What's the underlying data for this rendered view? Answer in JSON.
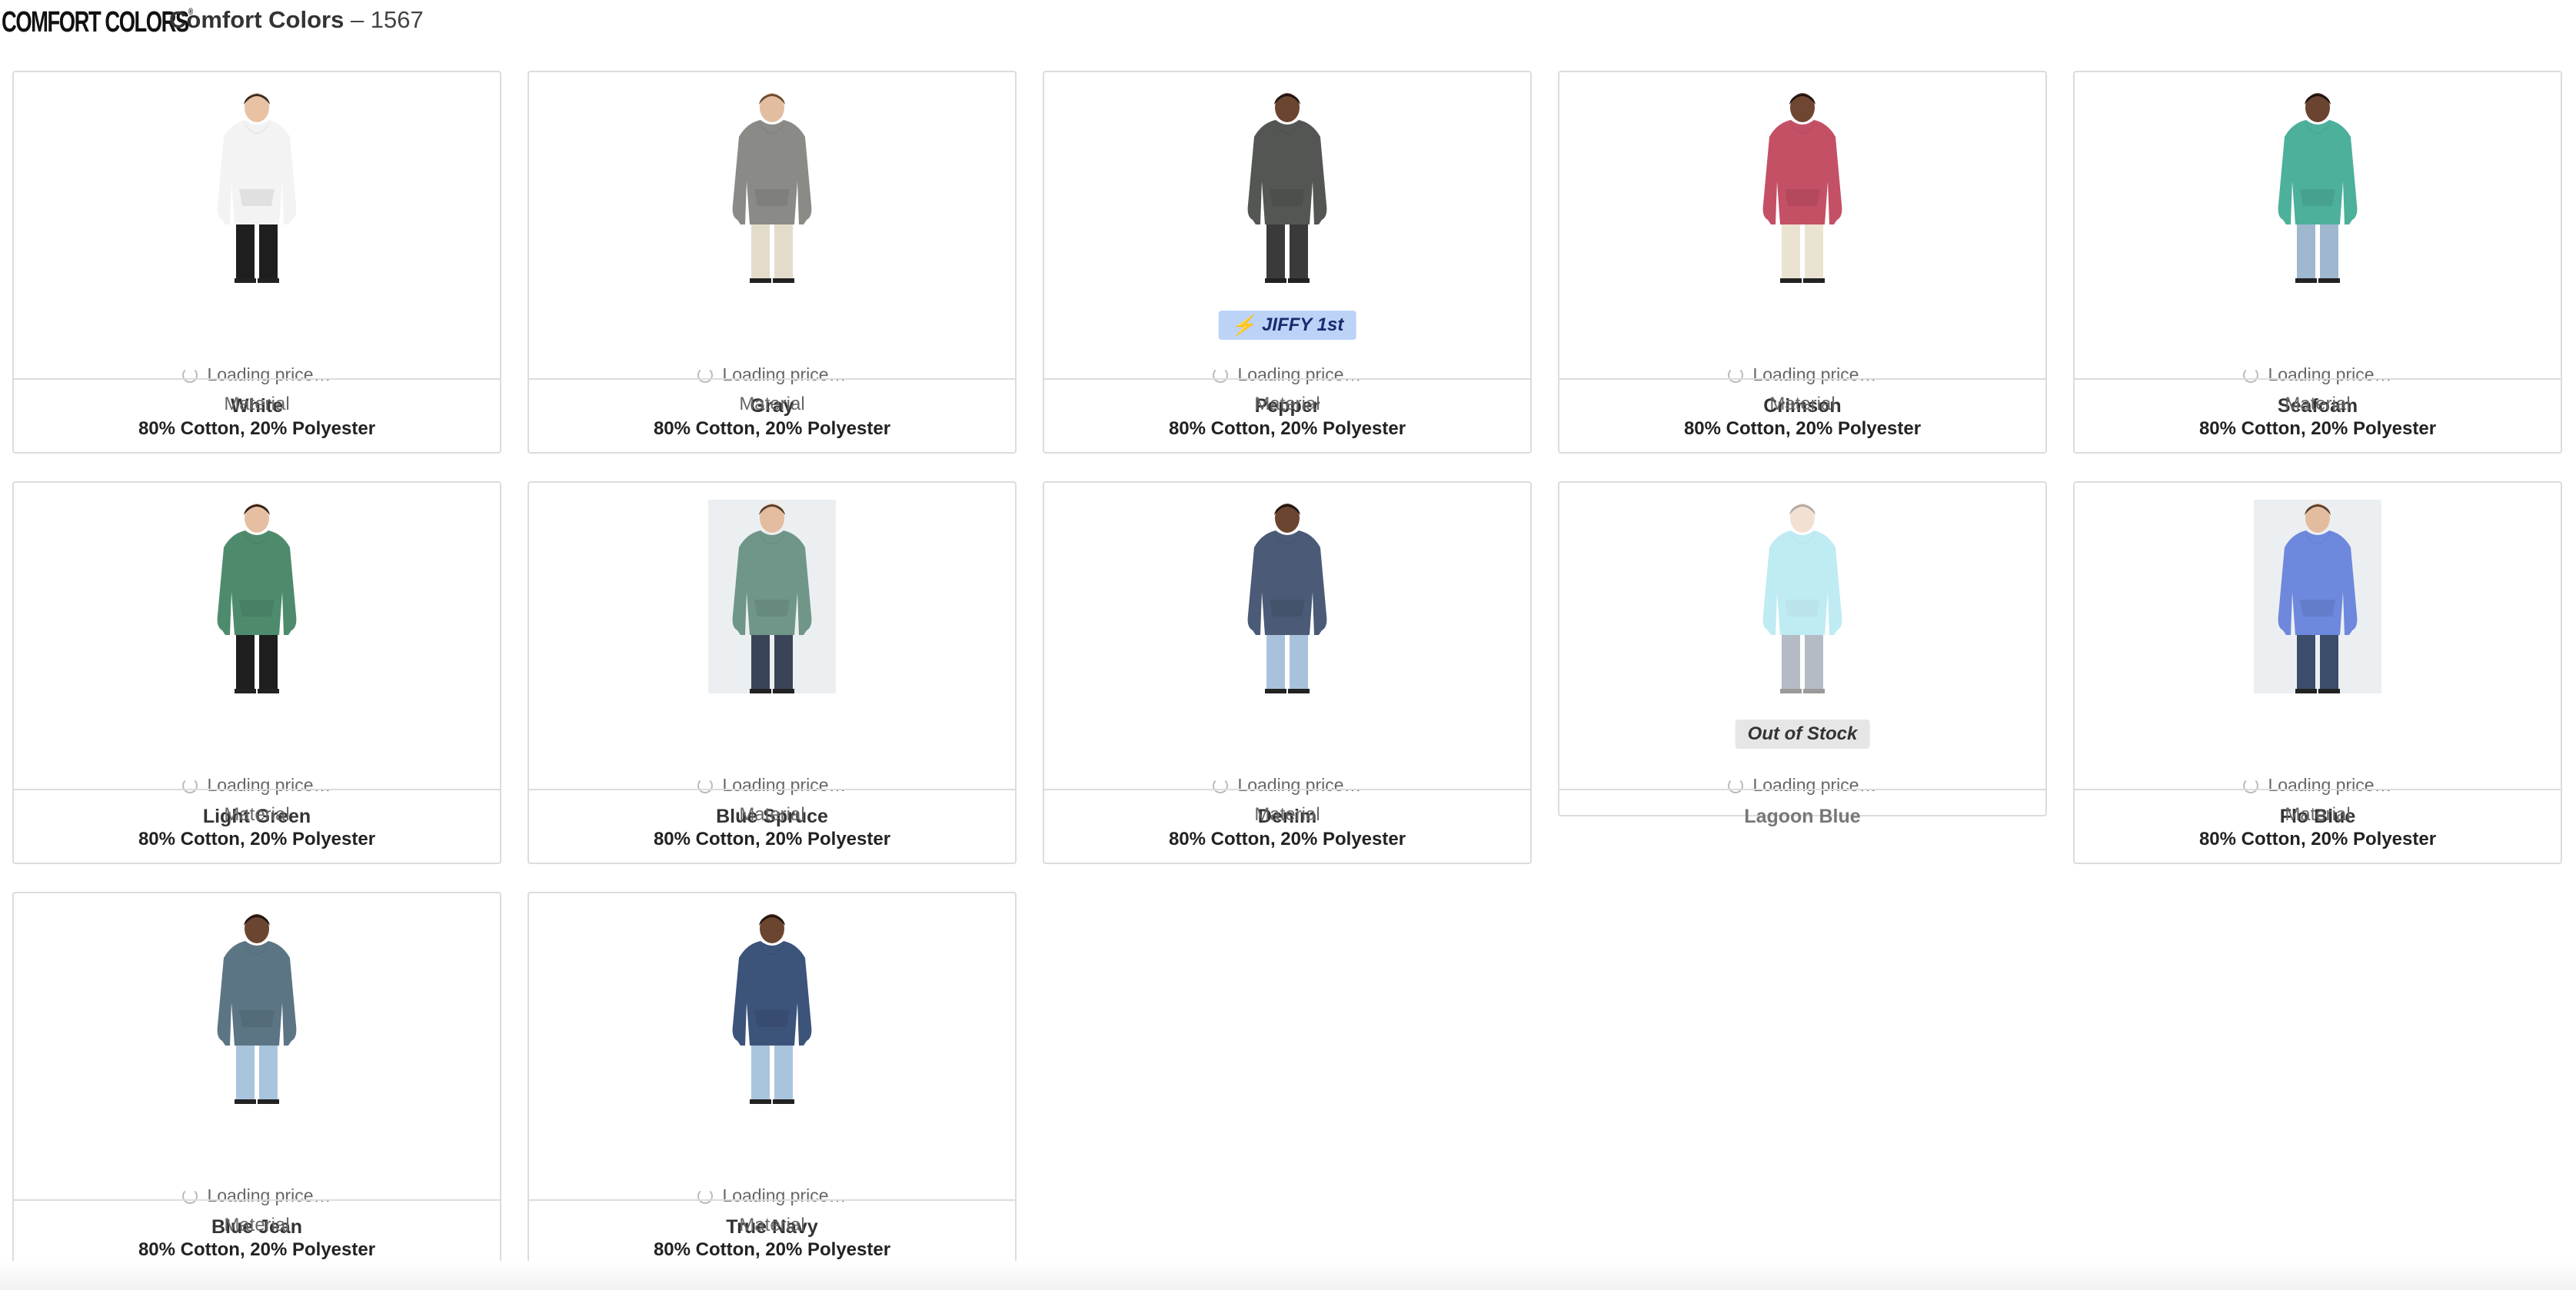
{
  "header": {
    "brand_logo": "COMFORT COLORS",
    "title": "Comfort Colors",
    "style_number": "– 1567"
  },
  "loading_text": "Loading price…",
  "material_label": "Material",
  "badges": {
    "jiffy": "JIFFY 1st",
    "out_of_stock": "Out of Stock"
  },
  "products": [
    {
      "name": "White",
      "material": "80% Cotton, 20% Polyester",
      "hoodie": "#f3f3f3",
      "pants": "#1e1e1e",
      "skin": "#e8c2a3",
      "hair": "#3a2a1e"
    },
    {
      "name": "Gray",
      "material": "80% Cotton, 20% Polyester",
      "hoodie": "#8a8a86",
      "pants": "#e4dccb",
      "skin": "#e3bda0",
      "hair": "#6b4a2e"
    },
    {
      "name": "Pepper",
      "material": "80% Cotton, 20% Polyester",
      "hoodie": "#545654",
      "pants": "#3a3a3a",
      "skin": "#6b4530",
      "hair": "#1e1410",
      "badge": "jiffy"
    },
    {
      "name": "Crimson",
      "material": "80% Cotton, 20% Polyester",
      "hoodie": "#c45066",
      "pants": "#eae3d2",
      "skin": "#6e4632",
      "hair": "#1e1410"
    },
    {
      "name": "Seafoam",
      "material": "80% Cotton, 20% Polyester",
      "hoodie": "#4db09a",
      "pants": "#9fb7cf",
      "skin": "#6a4331",
      "hair": "#1a120e"
    },
    {
      "name": "Light Green",
      "material": "80% Cotton, 20% Polyester",
      "hoodie": "#4e8b6d",
      "pants": "#1e1e1e",
      "skin": "#e6bfa2",
      "hair": "#2d1f16"
    },
    {
      "name": "Blue Spruce",
      "material": "80% Cotton, 20% Polyester",
      "hoodie": "#6f9688",
      "pants": "#3a4458",
      "skin": "#e4bca0",
      "hair": "#5a3f2a",
      "bg": true
    },
    {
      "name": "Denim",
      "material": "80% Cotton, 20% Polyester",
      "hoodie": "#4b5a76",
      "pants": "#a8c2dc",
      "skin": "#6b4530",
      "hair": "#1e1410"
    },
    {
      "name": "Lagoon Blue",
      "material": "",
      "hoodie": "#72d4e6",
      "pants": "#5b6a80",
      "skin": "#e3bda0",
      "hair": "#5a4030",
      "badge": "out_of_stock",
      "oos": true
    },
    {
      "name": "Flo Blue",
      "material": "80% Cotton, 20% Polyester",
      "hoodie": "#6d88dc",
      "pants": "#3b4d6a",
      "skin": "#e3bca0",
      "hair": "#5a3f2a",
      "bg": true
    },
    {
      "name": "Blue Jean",
      "material": "80% Cotton, 20% Polyester",
      "hoodie": "#5c7584",
      "pants": "#a9c4dd",
      "skin": "#6b4530",
      "hair": "#1e1410"
    },
    {
      "name": "True Navy",
      "material": "80% Cotton, 20% Polyester",
      "hoodie": "#3c537a",
      "pants": "#a9c4dd",
      "skin": "#6b4530",
      "hair": "#1e1410"
    }
  ]
}
